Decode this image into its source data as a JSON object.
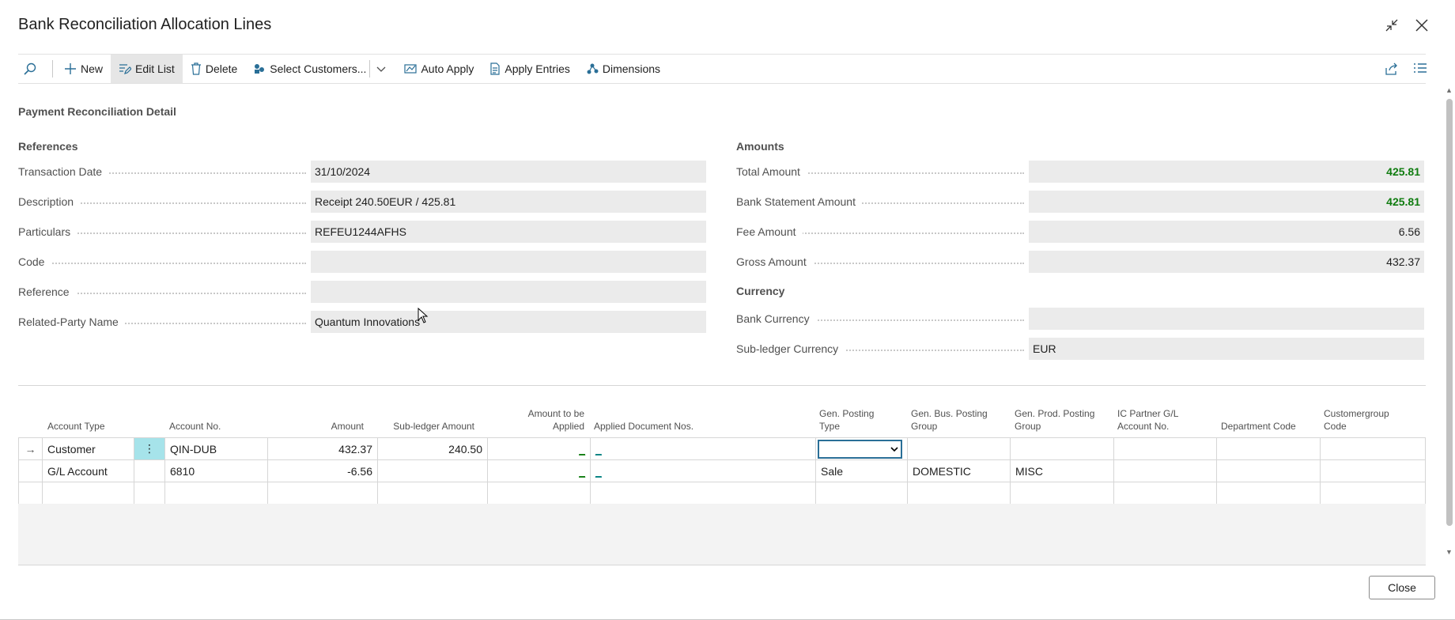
{
  "window": {
    "title": "Bank Reconciliation Allocation Lines",
    "collapse_icon": "collapse-icon",
    "close_icon": "close-icon"
  },
  "toolbar": {
    "new": "New",
    "edit_list": "Edit List",
    "delete": "Delete",
    "select_customers": "Select Customers...",
    "auto_apply": "Auto Apply",
    "apply_entries": "Apply Entries",
    "dimensions": "Dimensions"
  },
  "detail": {
    "section_title": "Payment Reconciliation Detail",
    "references": {
      "title": "References",
      "fields": [
        {
          "label": "Transaction Date",
          "value": "31/10/2024"
        },
        {
          "label": "Description",
          "value": "Receipt 240.50EUR / 425.81"
        },
        {
          "label": "Particulars",
          "value": "REFEU1244AFHS"
        },
        {
          "label": "Code",
          "value": ""
        },
        {
          "label": "Reference",
          "value": ""
        },
        {
          "label": "Related-Party Name",
          "value": "Quantum Innovations"
        }
      ]
    },
    "amounts": {
      "title": "Amounts",
      "fields": [
        {
          "label": "Total Amount",
          "value": "425.81"
        },
        {
          "label": "Bank Statement Amount",
          "value": "425.81"
        },
        {
          "label": "Fee Amount",
          "value": "6.56"
        },
        {
          "label": "Gross Amount",
          "value": "432.37"
        }
      ]
    },
    "currency": {
      "title": "Currency",
      "fields": [
        {
          "label": "Bank Currency",
          "value": ""
        },
        {
          "label": "Sub-ledger Currency",
          "value": "EUR"
        }
      ]
    }
  },
  "lines": {
    "columns": {
      "account_type": "Account Type",
      "account_no": "Account No.",
      "amount": "Amount",
      "subledger_amount": "Sub-ledger Amount",
      "amount_to_apply_1": "Amount to be",
      "amount_to_apply_2": "Applied",
      "applied_doc": "Applied Document Nos.",
      "gen_posting_1": "Gen. Posting",
      "gen_posting_2": "Type",
      "gen_bus_1": "Gen. Bus. Posting",
      "gen_bus_2": "Group",
      "gen_prod_1": "Gen. Prod. Posting",
      "gen_prod_2": "Group",
      "ic_partner_1": "IC Partner G/L",
      "ic_partner_2": "Account No.",
      "department": "Department Code",
      "custgroup_1": "Customergroup",
      "custgroup_2": "Code"
    },
    "rows": [
      {
        "account_type": "Customer",
        "account_no": "QIN-DUB",
        "amount": "432.37",
        "subledger_amount": "240.50",
        "amount_to_apply": "_",
        "applied_doc": "_",
        "gen_posting_type": "",
        "gen_bus_group": "",
        "gen_prod_group": ""
      },
      {
        "account_type": "G/L Account",
        "account_no": "6810",
        "amount": "-6.56",
        "subledger_amount": "",
        "amount_to_apply": "_",
        "applied_doc": "_",
        "gen_posting_type": "Sale",
        "gen_bus_group": "DOMESTIC",
        "gen_prod_group": "MISC"
      }
    ]
  },
  "footer": {
    "close": "Close"
  },
  "colors": {
    "accent_green": "#107c10",
    "selection_blue": "#2a6f97",
    "row_action_bg": "#a6e3ea"
  }
}
